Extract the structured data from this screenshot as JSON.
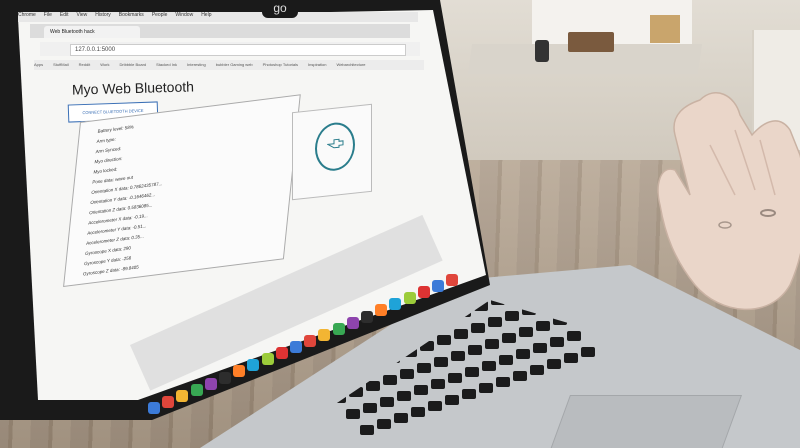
{
  "menubar": {
    "items": [
      "Chrome",
      "File",
      "Edit",
      "View",
      "History",
      "Bookmarks",
      "People",
      "Window",
      "Help"
    ]
  },
  "browser": {
    "tab_title": "Web Bluetooth hack",
    "url": "127.0.0.1:5000",
    "bookmarks": [
      "Apps",
      "StuffMail",
      "Reddit",
      "Work",
      "Dribbble Board",
      "Stacked Ink",
      "Interesting",
      "bubbler Gaming web",
      "Photoshop Tutorials",
      "Inspiration",
      "Webarchitecture"
    ]
  },
  "page": {
    "title": "Myo Web Bluetooth",
    "connect_button": "CONNECT BLUETOOTH DEVICE",
    "data_lines": [
      "Battery level: 58%",
      "Arm type:",
      "Arm Synced:",
      "Myo direction:",
      "Myo locked:",
      "Pose data: wave out",
      "Orientation X data: 0.7862435787...",
      "Orientation Y data: -0.1646462...",
      "Orientation Z data: 0.5836085...",
      "Accelerometer X data: -0.19...",
      "Accelerometer Y data: -0.51...",
      "Accelerometer Z data: 0.35...",
      "Gyroscope X data: 290",
      "Gyroscope Y data: -256",
      "Gyroscope Z data: -89.8405"
    ],
    "pose_icon": "wave-out-hand-icon"
  },
  "badge": {
    "text": "go",
    "icon": "go-logo-icon"
  },
  "colors": {
    "accent": "#2a7d8c",
    "button": "#3a6fb5"
  }
}
